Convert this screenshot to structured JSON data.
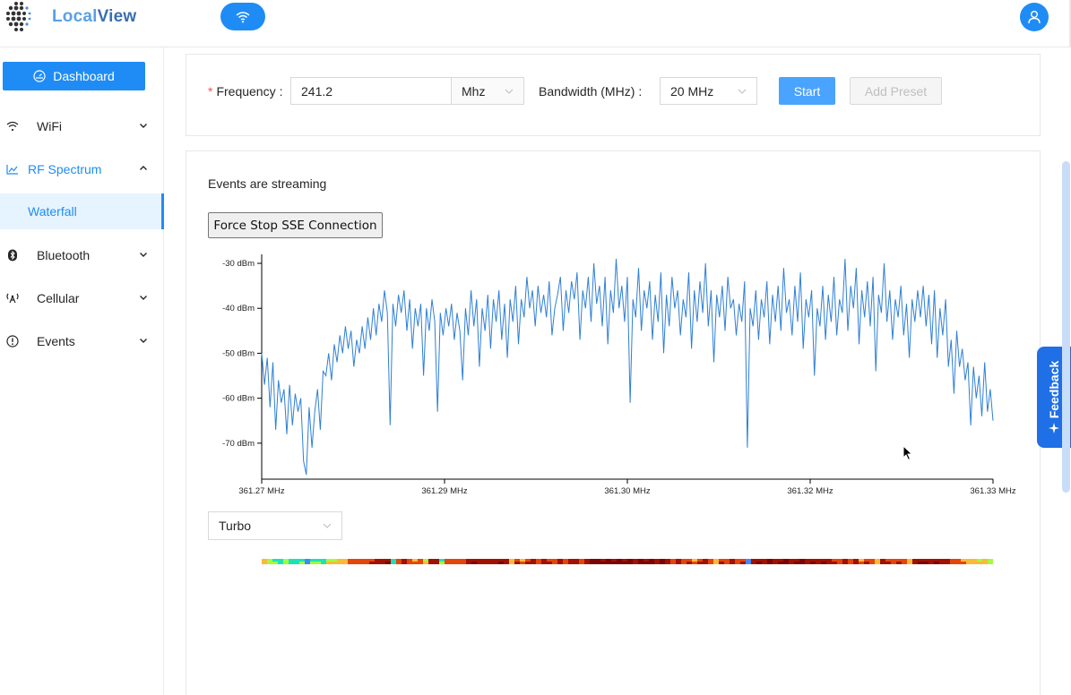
{
  "app": {
    "name_part1": "Local",
    "name_part2": "View"
  },
  "sidebar": {
    "dashboard_label": "Dashboard",
    "items": [
      {
        "label": "WiFi",
        "icon": "wifi-icon"
      },
      {
        "label": "RF Spectrum",
        "icon": "line-chart-icon"
      },
      {
        "label": "Bluetooth",
        "icon": "bluetooth-icon"
      },
      {
        "label": "Cellular",
        "icon": "antenna-icon"
      },
      {
        "label": "Events",
        "icon": "info-icon"
      }
    ],
    "sub_items": [
      {
        "label": "Waterfall"
      }
    ]
  },
  "form": {
    "frequency_label": "Frequency",
    "frequency_value": "241.2",
    "unit_value": "Mhz",
    "bandwidth_label": "Bandwidth (MHz)",
    "bandwidth_value": "20 MHz",
    "start_label": "Start",
    "add_preset_label": "Add Preset",
    "colon": ":"
  },
  "stream": {
    "status_text": "Events are streaming",
    "force_stop_label": "Force Stop SSE Connection"
  },
  "colormap": {
    "selected": "Turbo"
  },
  "feedback": {
    "label": "Feedback"
  },
  "colors": {
    "primary": "#1f8cf5",
    "line": "#2f7fd6",
    "feedback": "#1f6fe6"
  },
  "chart_data": {
    "type": "line",
    "title": "",
    "xlabel": "",
    "ylabel": "",
    "xlim": [
      361.27,
      361.33
    ],
    "ylim": [
      -78,
      -28
    ],
    "x_ticks": [
      {
        "value": 361.27,
        "label": "361.27 MHz"
      },
      {
        "value": 361.285,
        "label": "361.29 MHz"
      },
      {
        "value": 361.3,
        "label": "361.30 MHz"
      },
      {
        "value": 361.315,
        "label": "361.32 MHz"
      },
      {
        "value": 361.33,
        "label": "361.33 MHz"
      }
    ],
    "y_ticks": [
      {
        "value": -30,
        "label": "-30 dBm"
      },
      {
        "value": -40,
        "label": "-40 dBm"
      },
      {
        "value": -50,
        "label": "-50 dBm"
      },
      {
        "value": -60,
        "label": "-60 dBm"
      },
      {
        "value": -70,
        "label": "-70 dBm"
      }
    ],
    "series": [
      {
        "values": [
          -50,
          -57,
          -51,
          -62,
          -52,
          -67,
          -56,
          -61,
          -58,
          -68,
          -57,
          -66,
          -59,
          -63,
          -60,
          -74,
          -77,
          -62,
          -71,
          -63,
          -58,
          -67,
          -54,
          -55,
          -50,
          -56,
          -48,
          -52,
          -46,
          -50,
          -44,
          -49,
          -45,
          -53,
          -47,
          -50,
          -44,
          -49,
          -42,
          -47,
          -40,
          -46,
          -39,
          -43,
          -36,
          -41,
          -66,
          -39,
          -44,
          -37,
          -41,
          -36,
          -45,
          -38,
          -49,
          -40,
          -44,
          -39,
          -55,
          -40,
          -45,
          -38,
          -43,
          -63,
          -41,
          -46,
          -40,
          -44,
          -39,
          -47,
          -41,
          -45,
          -56,
          -40,
          -46,
          -36,
          -44,
          -38,
          -53,
          -40,
          -45,
          -37,
          -49,
          -38,
          -43,
          -36,
          -47,
          -39,
          -51,
          -38,
          -43,
          -35,
          -48,
          -38,
          -42,
          -33,
          -40,
          -36,
          -44,
          -35,
          -41,
          -37,
          -42,
          -34,
          -46,
          -40,
          -37,
          -33,
          -45,
          -36,
          -41,
          -34,
          -38,
          -32,
          -47,
          -36,
          -40,
          -33,
          -43,
          -30,
          -39,
          -35,
          -44,
          -33,
          -48,
          -36,
          -41,
          -29,
          -40,
          -35,
          -43,
          -33,
          -61,
          -38,
          -42,
          -31,
          -45,
          -36,
          -40,
          -34,
          -47,
          -37,
          -43,
          -32,
          -50,
          -37,
          -44,
          -33,
          -40,
          -36,
          -46,
          -38,
          -42,
          -32,
          -49,
          -36,
          -43,
          -34,
          -41,
          -30,
          -44,
          -36,
          -52,
          -37,
          -42,
          -35,
          -45,
          -33,
          -40,
          -38,
          -46,
          -39,
          -43,
          -34,
          -71,
          -40,
          -44,
          -36,
          -47,
          -38,
          -42,
          -34,
          -48,
          -37,
          -43,
          -35,
          -45,
          -31,
          -41,
          -38,
          -46,
          -35,
          -43,
          -32,
          -49,
          -38,
          -42,
          -36,
          -55,
          -40,
          -44,
          -35,
          -47,
          -37,
          -43,
          -33,
          -46,
          -38,
          -41,
          -29,
          -45,
          -35,
          -40,
          -31,
          -48,
          -36,
          -42,
          -34,
          -44,
          -33,
          -54,
          -37,
          -41,
          -30,
          -43,
          -36,
          -47,
          -38,
          -42,
          -35,
          -46,
          -39,
          -51,
          -38,
          -43,
          -36,
          -42,
          -35,
          -44,
          -37,
          -48,
          -36,
          -51,
          -40,
          -46,
          -38,
          -53,
          -47,
          -59,
          -45,
          -53,
          -49,
          -56,
          -52,
          -66,
          -53,
          -60,
          -55,
          -64,
          -52,
          -63,
          -58,
          -65
        ]
      }
    ],
    "grid": false,
    "legend": "none"
  }
}
